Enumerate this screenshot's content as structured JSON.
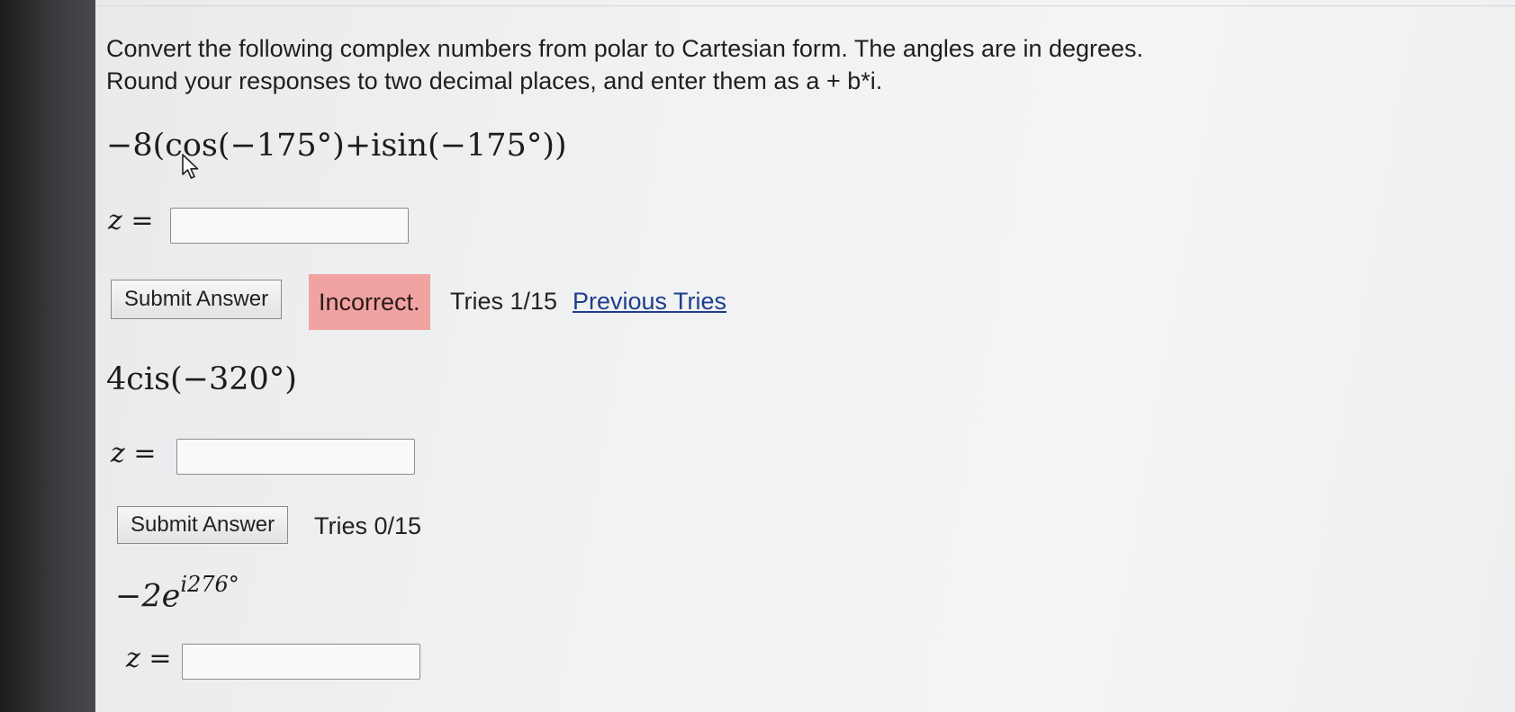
{
  "instructions": {
    "line1": "Convert the following complex numbers from polar to Cartesian form. The angles are in degrees.",
    "line2": "Round your responses to two decimal places, and enter them as a + b*i."
  },
  "problems": [
    {
      "expression": "−8(cos(−175°)+isin(−175°))",
      "z_label": "z =",
      "input_value": "",
      "submit_label": "Submit Answer",
      "status": "Incorrect.",
      "tries": "Tries 1/15",
      "previous_tries_link": "Previous Tries"
    },
    {
      "expression": "4cis(−320°)",
      "z_label": "z =",
      "input_value": "",
      "submit_label": "Submit Answer",
      "tries": "Tries 0/15"
    },
    {
      "expression_base": "−2e",
      "expression_exponent": "i276°",
      "z_label": "z =",
      "input_value": ""
    }
  ],
  "colors": {
    "incorrect_bg": "#f0a3a0",
    "link": "#1d3e8c"
  },
  "icons": [
    "mouse-pointer-icon"
  ]
}
